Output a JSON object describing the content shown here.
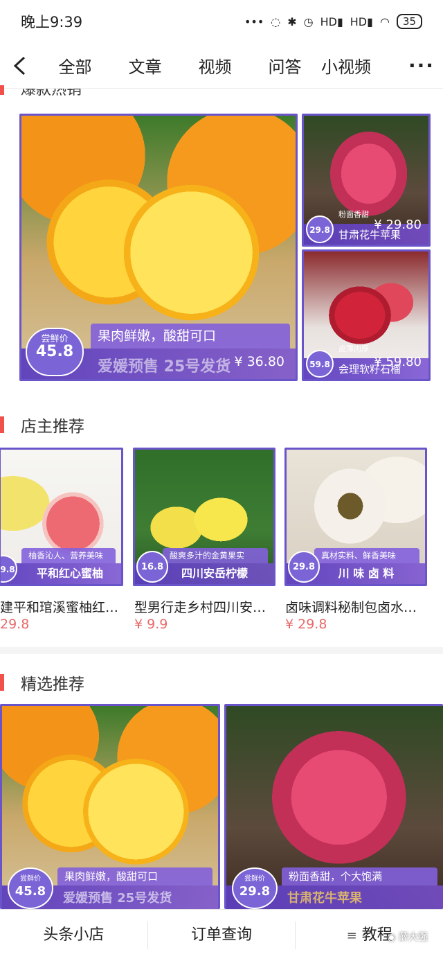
{
  "status_bar": {
    "time": "晚上9:39",
    "network_1": "HD",
    "network_2": "HD",
    "battery": "35"
  },
  "nav": {
    "tabs": [
      "全部",
      "文章",
      "视频",
      "问答",
      "小视频"
    ]
  },
  "sections": {
    "hot": {
      "title": "爆款热销",
      "big": {
        "tag": "尝鲜价",
        "badge_price": "45.8",
        "slogan": "果肉鲜嫩，酸甜可口",
        "sub": "爱媛预售 25号发货",
        "price": "¥ 36.80"
      },
      "top_right": {
        "badge_price": "29.8",
        "tag": "粉面香甜",
        "name": "甘肃花牛苹果",
        "price": "¥ 29.80"
      },
      "bottom_right": {
        "badge_price": "59.8",
        "tag": "皮薄肉厚",
        "name": "会理软籽石榴",
        "price": "¥ 59.80"
      }
    },
    "owner": {
      "title": "店主推荐",
      "items": [
        {
          "badge_price": "9.8",
          "tag": "柚香沁人、营养美味",
          "banner": "平和红心蜜柚",
          "name": "建平和琯溪蜜柚红…",
          "price": "29.8"
        },
        {
          "badge_price": "16.8",
          "tag": "酸爽多汁的金黄果实",
          "banner": "四川安岳柠檬",
          "name": "型男行走乡村四川安…",
          "price": "¥ 9.9"
        },
        {
          "badge_price": "29.8",
          "tag": "真材实料、鲜香美味",
          "banner": "川 味 卤 料",
          "name": "卤味调料秘制包卤水…",
          "price": "¥ 29.8"
        }
      ]
    },
    "selected": {
      "title": "精选推荐",
      "items": [
        {
          "tag": "尝鲜价",
          "badge_price": "45.8",
          "slogan": "果肉鲜嫩，酸甜可口",
          "sub": "爱媛预售 25号发货"
        },
        {
          "tag": "尝鲜价",
          "badge_price": "29.8",
          "slogan": "粉面香甜，个大饱满",
          "sub": "甘肃花牛苹果"
        }
      ]
    }
  },
  "bottom_nav": {
    "shop": "头条小店",
    "orders": "订单查询",
    "tutorial": "教程"
  },
  "watermark": "薛大强",
  "colors": {
    "accent": "#f0524b",
    "banner_purple": "#6a54c9",
    "price_red": "#e86a6a"
  }
}
